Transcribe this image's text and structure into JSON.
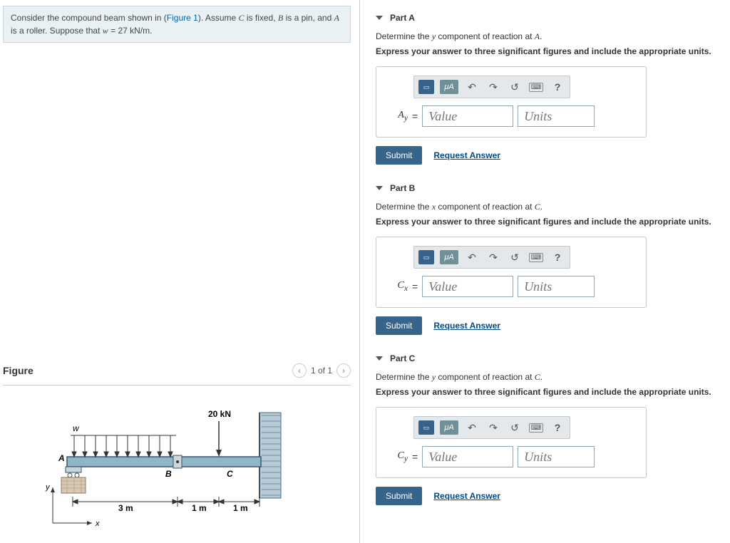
{
  "problem": {
    "prefix": "Consider the compound beam shown in (",
    "figure_link": "Figure 1",
    "mid1": "). Assume ",
    "var_c": "C",
    "mid2": " is fixed, ",
    "var_b": "B",
    "mid3": " is a pin, and ",
    "var_a": "A",
    "mid4": " is a roller. Suppose that ",
    "var_w": "w",
    "eq": " = 27 kN/m",
    "suffix": "."
  },
  "figure": {
    "title": "Figure",
    "pager": "1 of 1",
    "load_label": "20 kN",
    "dim1": "3 m",
    "dim2": "1 m",
    "dim3": "1 m",
    "pt_a": "A",
    "pt_b": "B",
    "pt_c": "C",
    "w_label": "w",
    "x": "x",
    "y": "y"
  },
  "ui": {
    "value_ph": "Value",
    "units_ph": "Units",
    "submit": "Submit",
    "request": "Request Answer",
    "mua": "μA",
    "help": "?"
  },
  "parts": [
    {
      "title": "Part A",
      "prompt_pre": "Determine the ",
      "prompt_var": "y",
      "prompt_mid": " component of reaction at ",
      "prompt_pt": "A",
      "prompt_post": ".",
      "instruct": "Express your answer to three significant figures and include the appropriate units.",
      "var_html": "A",
      "var_sub": "y"
    },
    {
      "title": "Part B",
      "prompt_pre": "Determine the ",
      "prompt_var": "x",
      "prompt_mid": " component of reaction at ",
      "prompt_pt": "C",
      "prompt_post": ".",
      "instruct": "Express your answer to three significant figures and include the appropriate units.",
      "var_html": "C",
      "var_sub": "x"
    },
    {
      "title": "Part C",
      "prompt_pre": "Determine the ",
      "prompt_var": "y",
      "prompt_mid": " component of reaction at ",
      "prompt_pt": "C",
      "prompt_post": ".",
      "instruct": "Express your answer to three significant figures and include the appropriate units.",
      "var_html": "C",
      "var_sub": "y"
    }
  ]
}
